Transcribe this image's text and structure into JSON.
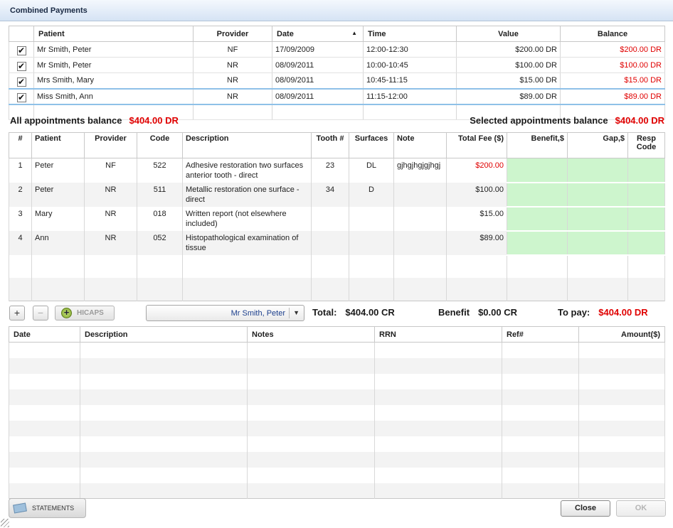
{
  "window": {
    "title": "Combined Payments"
  },
  "appointments": {
    "columns": [
      "Patient",
      "Provider",
      "Date",
      "Time",
      "Value",
      "Balance"
    ],
    "sort_indicator": "▲",
    "rows": [
      {
        "checked": "✔",
        "patient": "Mr Smith, Peter",
        "provider": "NF",
        "date": "17/09/2009",
        "time": "12:00-12:30",
        "value": "$200.00 DR",
        "balance": "$200.00 DR"
      },
      {
        "checked": "✔",
        "patient": "Mr Smith, Peter",
        "provider": "NR",
        "date": "08/09/2011",
        "time": "10:00-10:45",
        "value": "$100.00 DR",
        "balance": "$100.00 DR"
      },
      {
        "checked": "✔",
        "patient": "Mrs Smith, Mary",
        "provider": "NR",
        "date": "08/09/2011",
        "time": "10:45-11:15",
        "value": "$15.00 DR",
        "balance": "$15.00 DR"
      },
      {
        "checked": "✔",
        "patient": "Miss Smith, Ann",
        "provider": "NR",
        "date": "08/09/2011",
        "time": "11:15-12:00",
        "value": "$89.00 DR",
        "balance": "$89.00 DR"
      }
    ]
  },
  "balances": {
    "all_label": "All appointments balance",
    "all_value": "$404.00 DR",
    "selected_label": "Selected appointments balance",
    "selected_value": "$404.00 DR"
  },
  "items": {
    "columns": [
      "#",
      "Patient",
      "Provider",
      "Code",
      "Description",
      "Tooth #",
      "Surfaces",
      "Note",
      "Total Fee ($)",
      "Benefit,$",
      "Gap,$",
      "Resp Code"
    ],
    "rows": [
      {
        "num": "1",
        "patient": "Peter",
        "provider": "NF",
        "code": "522",
        "description": "Adhesive restoration  two surfaces  anterior tooth - direct",
        "tooth": "23",
        "surfaces": "DL",
        "note": "gjhgjhgjgjhgj",
        "fee": "$200.00"
      },
      {
        "num": "2",
        "patient": "Peter",
        "provider": "NR",
        "code": "511",
        "description": "Metallic restoration  one surface - direct",
        "tooth": "34",
        "surfaces": "D",
        "note": "",
        "fee": "$100.00"
      },
      {
        "num": "3",
        "patient": "Mary",
        "provider": "NR",
        "code": "018",
        "description": "Written report (not elsewhere included)",
        "tooth": "",
        "surfaces": "",
        "note": "",
        "fee": "$15.00"
      },
      {
        "num": "4",
        "patient": "Ann",
        "provider": "NR",
        "code": "052",
        "description": "Histopathological examination of tissue",
        "tooth": "",
        "surfaces": "",
        "note": "",
        "fee": "$89.00"
      }
    ]
  },
  "toolbar": {
    "add_label": "+",
    "remove_label": "−",
    "hicaps_icon": "+",
    "hicaps_label": "HICAPS",
    "patient_select": "Mr Smith, Peter",
    "select_arrow": "▼"
  },
  "totals": {
    "total_label": "Total:",
    "total_value": "$404.00 CR",
    "benefit_label": "Benefit",
    "benefit_value": "$0.00 CR",
    "topay_label": "To pay:",
    "topay_value": "$404.00 DR"
  },
  "payments": {
    "columns": [
      "Date",
      "Description",
      "Notes",
      "RRN",
      "Ref#",
      "Amount($)"
    ]
  },
  "footer": {
    "statements_label": "STATEMENTS",
    "close_label": "Close",
    "ok_label": "OK"
  },
  "colors": {
    "balance_red": "#e00000",
    "benefit_green": "#cdf5cd",
    "title_gradient": "#d5e3f4"
  }
}
